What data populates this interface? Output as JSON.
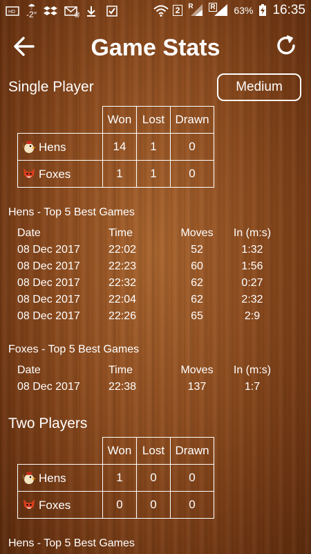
{
  "status_bar": {
    "carrier_icon": "hd-icon",
    "temperature": "-2°",
    "sim_badge": "2",
    "roaming_badge": "R",
    "battery": "63%",
    "time": "16:35"
  },
  "header": {
    "title": "Game Stats"
  },
  "single_player": {
    "title": "Single Player",
    "difficulty": "Medium",
    "table": {
      "headers": [
        "Won",
        "Lost",
        "Drawn"
      ],
      "rows": [
        {
          "name": "Hens",
          "won": "14",
          "lost": "1",
          "drawn": "0"
        },
        {
          "name": "Foxes",
          "won": "1",
          "lost": "1",
          "drawn": "0"
        }
      ]
    },
    "hens_top": {
      "title": "Hens - Top 5 Best Games",
      "columns": [
        "Date",
        "Time",
        "Moves",
        "In (m:s)"
      ],
      "rows": [
        [
          "08 Dec 2017",
          "22:02",
          "52",
          "1:32"
        ],
        [
          "08 Dec 2017",
          "22:23",
          "60",
          "1:56"
        ],
        [
          "08 Dec 2017",
          "22:32",
          "62",
          "0:27"
        ],
        [
          "08 Dec 2017",
          "22:04",
          "62",
          "2:32"
        ],
        [
          "08 Dec 2017",
          "22:26",
          "65",
          "2:9"
        ]
      ]
    },
    "foxes_top": {
      "title": "Foxes - Top 5 Best Games",
      "columns": [
        "Date",
        "Time",
        "Moves",
        "In (m:s)"
      ],
      "rows": [
        [
          "08 Dec 2017",
          "22:38",
          "137",
          "1:7"
        ]
      ]
    }
  },
  "two_players": {
    "title": "Two Players",
    "table": {
      "headers": [
        "Won",
        "Lost",
        "Drawn"
      ],
      "rows": [
        {
          "name": "Hens",
          "won": "1",
          "lost": "0",
          "drawn": "0"
        },
        {
          "name": "Foxes",
          "won": "0",
          "lost": "0",
          "drawn": "0"
        }
      ]
    },
    "hens_top_title": "Hens - Top 5 Best Games"
  }
}
